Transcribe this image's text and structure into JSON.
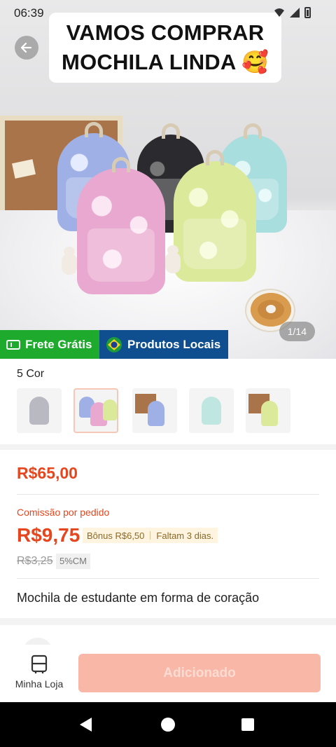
{
  "status_bar": {
    "time": "06:39"
  },
  "caption": {
    "line1": "VAMOS COMPRAR",
    "line2": "MOCHILA LINDA 🥰"
  },
  "gallery": {
    "counter": "1/14"
  },
  "badges": {
    "free_shipping": "Frete Grátis",
    "local_products": "Produtos Locais"
  },
  "variants": {
    "label": "5 Cor",
    "thumbnails": [
      {
        "name": "gray",
        "color": "#b9b9c2"
      },
      {
        "name": "pink",
        "color": "#e9a8cf",
        "selected": true
      },
      {
        "name": "blue",
        "color": "#9fb0e6"
      },
      {
        "name": "mint",
        "color": "#bfe6e0"
      },
      {
        "name": "yellow",
        "color": "#dbe99a"
      }
    ]
  },
  "pricing": {
    "price": "R$65,00",
    "commission_label": "Comissão por pedido",
    "commission_value": "R$9,75",
    "bonus": "Bônus R$6,50",
    "days_left": "Faltam 3 dias.",
    "old_commission": "R$3,25",
    "rate": "5%CM"
  },
  "product": {
    "title": "Mochila de estudante em forma de coração"
  },
  "actions": {
    "store_label": "Minha Loja",
    "add_label": "Adicionado"
  },
  "colors": {
    "accent": "#e6461e",
    "frete_green": "#1eaa2d",
    "local_blue": "#0f4f8f",
    "add_button": "#f8b7a7"
  }
}
